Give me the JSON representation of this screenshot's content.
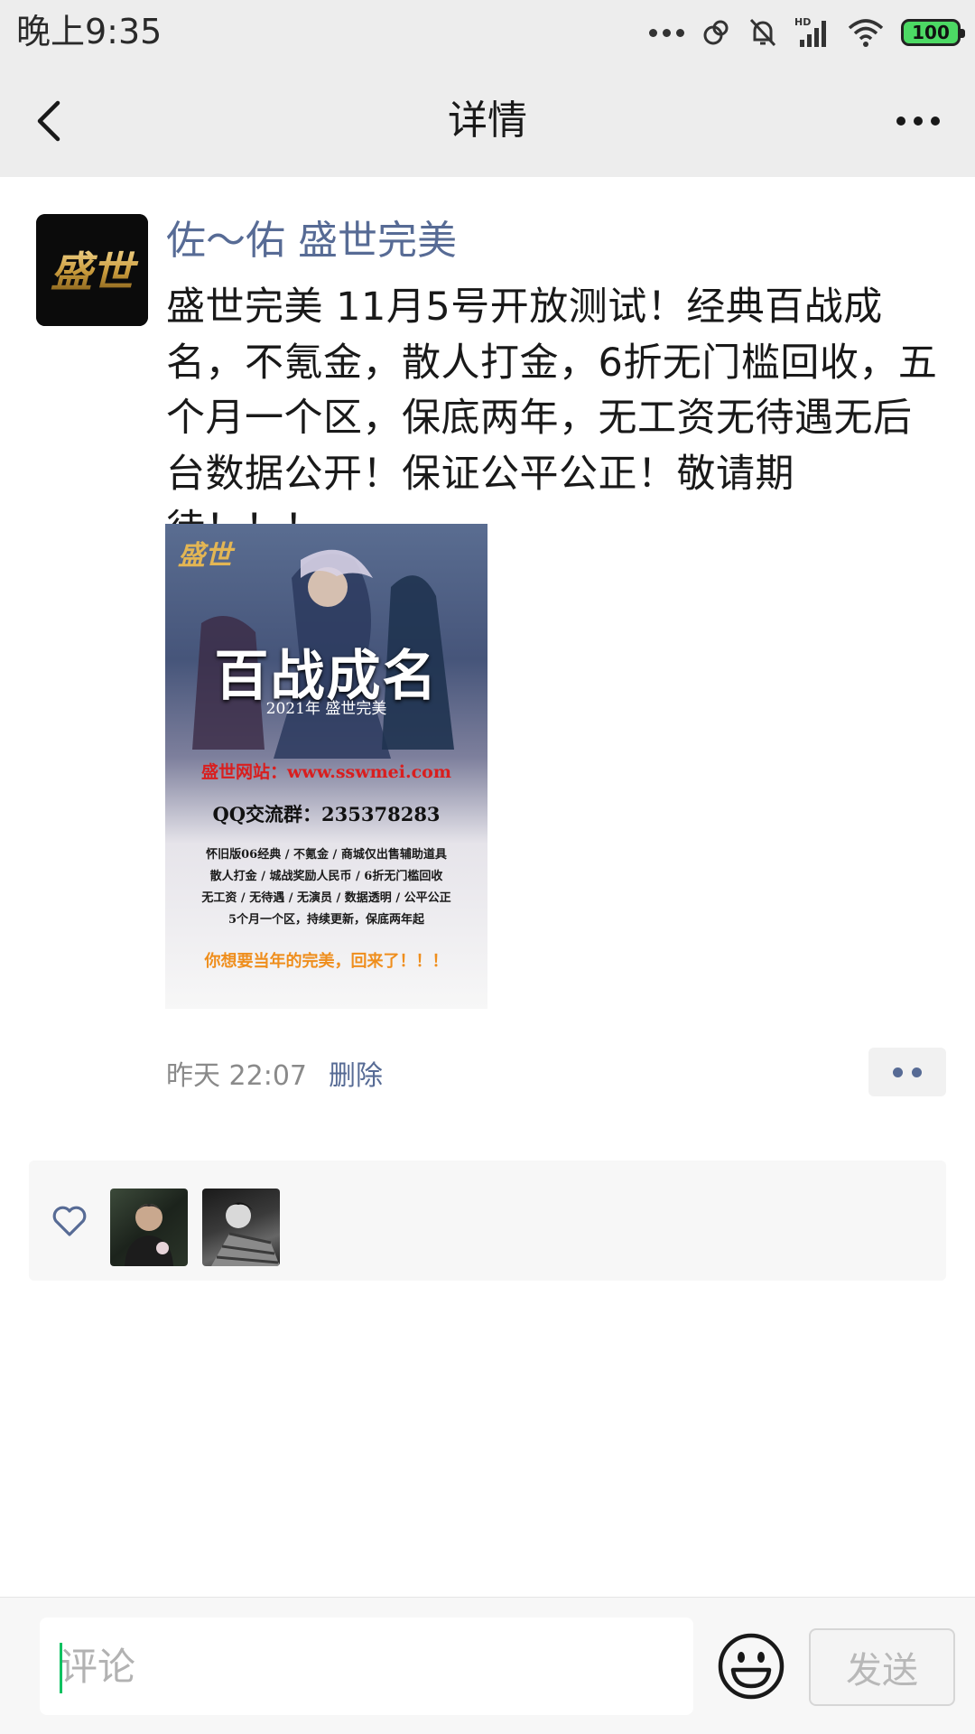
{
  "status_bar": {
    "time": "晚上9:35",
    "signal_badge": "HD",
    "battery": "100",
    "icons": [
      "more-dots-icon",
      "link-icon",
      "mute-bell-icon",
      "signal-icon",
      "wifi-icon",
      "battery-icon"
    ]
  },
  "header": {
    "title": "详情",
    "back_icon": "chevron-left-icon",
    "more_icon": "more-horizontal-icon"
  },
  "post": {
    "author": "佐～佑 盛世完美",
    "avatar_text": "盛世",
    "text": "盛世完美  11月5号开放测试！经典百战成名，不氪金，散人打金，6折无门槛回收，五个月一个区，保底两年，无工资无待遇无后台数据公开！保证公平公正！敬请期待！！！",
    "image": {
      "logo": "盛世",
      "title": "百战成名",
      "year_line": "2021年   盛世完美",
      "site": "盛世网站：www.sswmei.com",
      "qq": "QQ交流群：235378283",
      "lines": [
        "怀旧版06经典 / 不氪金 / 商城仅出售辅助道具",
        "散人打金 / 城战奖励人民币 / 6折无门槛回收",
        "无工资 / 无待遇 / 无演员 / 数据透明 / 公平公正",
        "5个月一个区，持续更新，保底两年起"
      ],
      "slogan": "你想要当年的完美，回来了！！！"
    },
    "time": "昨天 22:07",
    "delete_label": "删除",
    "action_icon": "comment-like-dots-icon"
  },
  "likes": {
    "icon": "heart-outline-icon",
    "count_avatars": 2
  },
  "comment": {
    "placeholder": "评论",
    "emoji_icon": "smiley-face-icon",
    "send_label": "发送"
  },
  "colors": {
    "link": "#576b95",
    "background_gray": "#ededed",
    "caret": "#07c160"
  }
}
